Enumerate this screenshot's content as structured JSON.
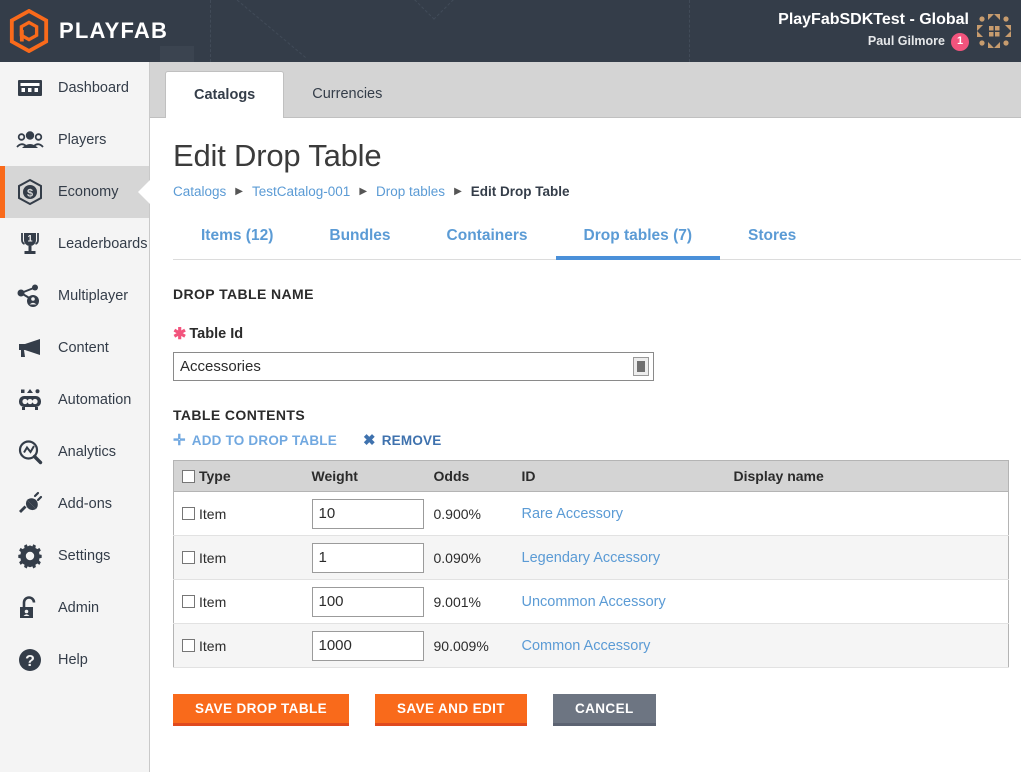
{
  "topbar": {
    "logo_text": "PLAYFAB",
    "account_title": "PlayFabSDKTest - Global",
    "user_name": "Paul Gilmore",
    "badge_count": "1",
    "logo_icon": "playfab-hex-logo",
    "avatar_icon": "identicon-avatar"
  },
  "sidebar": {
    "items": [
      {
        "label": "Dashboard",
        "icon": "dashboard-icon",
        "active": false
      },
      {
        "label": "Players",
        "icon": "players-icon",
        "active": false
      },
      {
        "label": "Economy",
        "icon": "economy-coin-icon",
        "active": true
      },
      {
        "label": "Leaderboards",
        "icon": "trophy-icon",
        "active": false
      },
      {
        "label": "Multiplayer",
        "icon": "multiplayer-icon",
        "active": false
      },
      {
        "label": "Content",
        "icon": "megaphone-icon",
        "active": false
      },
      {
        "label": "Automation",
        "icon": "automation-icon",
        "active": false
      },
      {
        "label": "Analytics",
        "icon": "analytics-icon",
        "active": false
      },
      {
        "label": "Add-ons",
        "icon": "plug-icon",
        "active": false
      },
      {
        "label": "Settings",
        "icon": "gear-icon",
        "active": false
      },
      {
        "label": "Admin",
        "icon": "lock-icon",
        "active": false
      },
      {
        "label": "Help",
        "icon": "question-icon",
        "active": false
      }
    ]
  },
  "tabs": [
    {
      "label": "Catalogs",
      "active": true
    },
    {
      "label": "Currencies",
      "active": false
    }
  ],
  "page": {
    "title": "Edit Drop Table",
    "breadcrumb": [
      {
        "label": "Catalogs",
        "current": false
      },
      {
        "label": "TestCatalog-001",
        "current": false
      },
      {
        "label": "Drop tables",
        "current": false
      },
      {
        "label": "Edit Drop Table",
        "current": true
      }
    ],
    "breadcrumb_separator": "▶"
  },
  "subtabs": [
    {
      "label": "Items (12)",
      "active": false
    },
    {
      "label": "Bundles",
      "active": false
    },
    {
      "label": "Containers",
      "active": false
    },
    {
      "label": "Drop tables (7)",
      "active": true
    },
    {
      "label": "Stores",
      "active": false
    }
  ],
  "name_section": {
    "heading": "DROP TABLE NAME",
    "field_label": "Table Id",
    "required_marker": "✱",
    "table_id_value": "Accessories",
    "table_id_placeholder": "Table Id",
    "picker_icon": "contact-card-icon"
  },
  "contents_section": {
    "heading": "TABLE CONTENTS",
    "add_label": "ADD TO DROP TABLE",
    "add_glyph": "➕",
    "remove_label": "REMOVE",
    "remove_glyph": "✖",
    "columns": [
      "Type",
      "Weight",
      "Odds",
      "ID",
      "Display name"
    ],
    "rows": [
      {
        "type": "Item",
        "weight": "10",
        "odds": "0.900%",
        "id": "Rare Accessory",
        "display_name": ""
      },
      {
        "type": "Item",
        "weight": "1",
        "odds": "0.090%",
        "id": "Legendary Accessory",
        "display_name": ""
      },
      {
        "type": "Item",
        "weight": "100",
        "odds": "9.001%",
        "id": "Uncommon Accessory",
        "display_name": ""
      },
      {
        "type": "Item",
        "weight": "1000",
        "odds": "90.009%",
        "id": "Common Accessory",
        "display_name": ""
      }
    ]
  },
  "buttons": {
    "save": "SAVE DROP TABLE",
    "save_and_edit": "SAVE AND EDIT",
    "cancel": "CANCEL"
  },
  "colors": {
    "brand_orange": "#f96a1b",
    "header_dark": "#343d49",
    "link_blue": "#5b9bd5",
    "accent_blue": "#4a90d9",
    "badge_pink": "#f2547d",
    "cancel_gray": "#6d7582"
  }
}
